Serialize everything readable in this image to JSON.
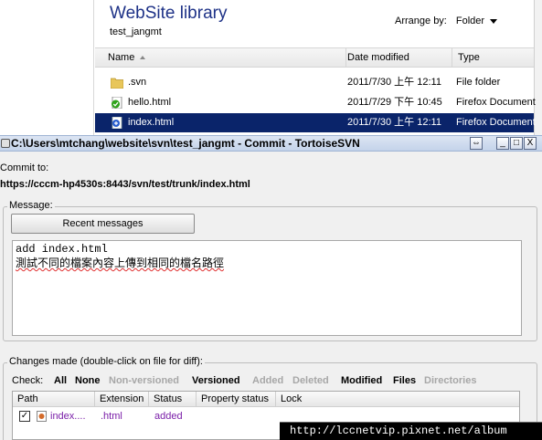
{
  "explorer": {
    "library_title": "WebSite library",
    "library_subtitle": "test_jangmt",
    "arrange_label": "Arrange by:",
    "arrange_value": "Folder",
    "columns": {
      "name": "Name",
      "date": "Date modified",
      "type": "Type"
    },
    "files": [
      {
        "name": ".svn",
        "date": "2011/7/30 上午 12:11",
        "type": "File folder",
        "icon": "folder-icon"
      },
      {
        "name": "hello.html",
        "date": "2011/7/29 下午 10:45",
        "type": "Firefox Document",
        "icon": "svn-ok-file-icon"
      },
      {
        "name": "index.html",
        "date": "2011/7/30 上午 12:11",
        "type": "Firefox Document",
        "icon": "svn-added-file-icon",
        "selected": true
      }
    ]
  },
  "dialog": {
    "title": "C:\\Users\\mtchang\\website\\svn\\test_jangmt - Commit - TortoiseSVN",
    "commit_to_label": "Commit to:",
    "commit_url": "https://cccm-hp4530s:8443/svn/test/trunk/index.html",
    "message_group": "Message:",
    "recent_messages_button": "Recent messages",
    "message_line1": "add index.html",
    "message_line2": "測試不同的檔案內容上傳到相同的檔名路徑",
    "changes_group": "Changes made (double-click on file for diff):",
    "check_label": "Check:",
    "filters": [
      {
        "label": "All",
        "enabled": true
      },
      {
        "label": "None",
        "enabled": true
      },
      {
        "label": "Non-versioned",
        "enabled": false
      },
      {
        "label": "Versioned",
        "enabled": true
      },
      {
        "label": "Added",
        "enabled": false
      },
      {
        "label": "Deleted",
        "enabled": false
      },
      {
        "label": "Modified",
        "enabled": true
      },
      {
        "label": "Files",
        "enabled": true
      },
      {
        "label": "Directories",
        "enabled": false
      }
    ],
    "list_columns": {
      "path": "Path",
      "extension": "Extension",
      "status": "Status",
      "property_status": "Property status",
      "lock": "Lock"
    },
    "list_rows": [
      {
        "path": "index....",
        "extension": ".html",
        "status": "added",
        "checked": true
      }
    ],
    "window_buttons": {
      "restore": "⇔",
      "minimize": "_",
      "maximize": "□",
      "close": "X"
    }
  },
  "watermark": "http://lccnetvip.pixnet.net/album",
  "colors": {
    "selection": "#0a246a",
    "title_bar": "#c4d3ea",
    "added_text": "#7a1ea8",
    "disabled_text": "#a7a7a7",
    "library_title": "#1e3287"
  }
}
